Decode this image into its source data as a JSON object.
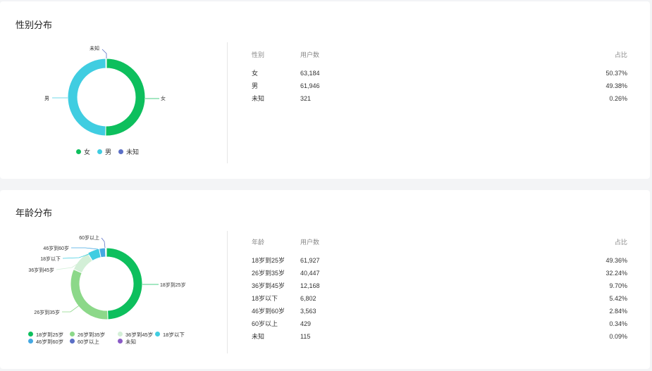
{
  "gender": {
    "title": "性别分布",
    "table": {
      "headers": [
        "性别",
        "用户数",
        "占比"
      ],
      "rows": [
        {
          "name": "女",
          "count": "63,184",
          "pct": "50.37%"
        },
        {
          "name": "男",
          "count": "61,946",
          "pct": "49.38%"
        },
        {
          "name": "未知",
          "count": "321",
          "pct": "0.26%"
        }
      ]
    }
  },
  "age": {
    "title": "年龄分布",
    "table": {
      "headers": [
        "年龄",
        "用户数",
        "占比"
      ],
      "rows": [
        {
          "name": "18岁到25岁",
          "count": "61,927",
          "pct": "49.36%"
        },
        {
          "name": "26岁到35岁",
          "count": "40,447",
          "pct": "32.24%"
        },
        {
          "name": "36岁到45岁",
          "count": "12,168",
          "pct": "9.70%"
        },
        {
          "name": "18岁以下",
          "count": "6,802",
          "pct": "5.42%"
        },
        {
          "name": "46岁到60岁",
          "count": "3,563",
          "pct": "2.84%"
        },
        {
          "name": "60岁以上",
          "count": "429",
          "pct": "0.34%"
        },
        {
          "name": "未知",
          "count": "115",
          "pct": "0.09%"
        }
      ]
    }
  },
  "chart_data": [
    {
      "type": "pie",
      "subtype": "donut",
      "title": "",
      "categories": [
        "女",
        "男",
        "未知"
      ],
      "values": [
        63184,
        61946,
        321
      ],
      "colors": [
        "#0dbf5d",
        "#40cde1",
        "#5b6fc6"
      ],
      "legend": "bottom"
    },
    {
      "type": "pie",
      "subtype": "donut",
      "title": "",
      "categories": [
        "18岁到25岁",
        "26岁到35岁",
        "36岁到45岁",
        "18岁以下",
        "46岁到60岁",
        "60岁以上",
        "未知"
      ],
      "values": [
        61927,
        40447,
        12168,
        6802,
        3563,
        429,
        115
      ],
      "colors": [
        "#0dbf5d",
        "#8cd889",
        "#d3efd7",
        "#40cde1",
        "#45a8e2",
        "#5b6fc6",
        "#8a5bc6"
      ],
      "legend": "bottom"
    }
  ]
}
